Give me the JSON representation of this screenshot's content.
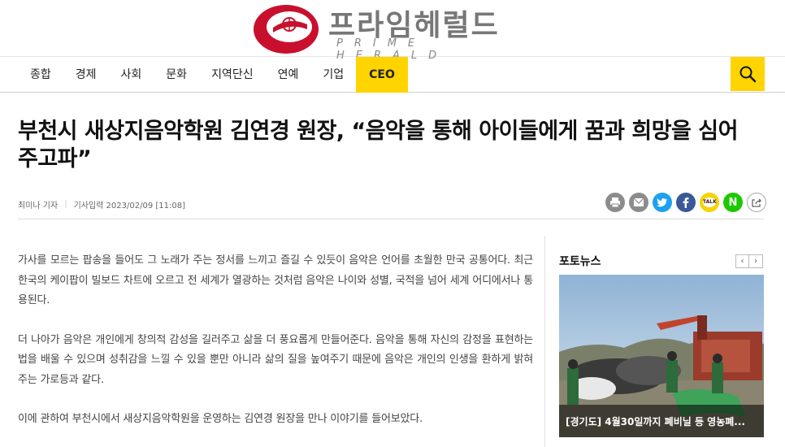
{
  "logo": {
    "title": "프라임헤럴드",
    "subtitle": "PRIME HERALD",
    "colors": {
      "mark": "#c8102e",
      "text": "#777777"
    }
  },
  "nav": {
    "items": [
      {
        "label": "종합"
      },
      {
        "label": "경제"
      },
      {
        "label": "사회"
      },
      {
        "label": "문화"
      },
      {
        "label": "지역단신"
      },
      {
        "label": "연예"
      },
      {
        "label": "기업"
      },
      {
        "label": "CEO",
        "active": true
      }
    ],
    "search_icon": "search-icon",
    "accent": "#ffd400"
  },
  "article": {
    "headline": "부천시 새상지음악학원 김연경 원장, “음악을 통해 아이들에게 꿈과 희망을 심어주고파”",
    "author": "최미나 기자",
    "date_label": "기사입력 2023/02/09 [11:08]",
    "paragraphs": [
      "가사를 모르는 팝송을 들어도 그 노래가 주는 정서를 느끼고 즐길 수 있듯이 음악은 언어를 초월한 만국 공통어다. 최근 한국의 케이팝이 빌보드 차트에 오르고 전 세계가 열광하는 것처럼 음악은 나이와 성별, 국적을 넘어 세계 어디에서나 통용된다.",
      "더 나아가 음악은 개인에게 창의적 감성을 길러주고 삶을 더 풍요롭게 만들어준다. 음악을 통해 자신의 감정을 표현하는 법을 배울 수 있으며 성취감을 느낄 수 있을 뿐만 아니라 삶의 질을 높여주기 때문에 음악은 개인의 인생을 환하게 밝혀주는 가로등과 같다.",
      "이에 관하여 부천시에서 새상지음악학원을 운영하는 김연경 원장을 만나 이야기를 들어보았다."
    ]
  },
  "share": {
    "buttons": [
      {
        "icon": "print-icon",
        "color": "#8c8c8c"
      },
      {
        "icon": "email-icon",
        "color": "#8c8c8c"
      },
      {
        "icon": "twitter-icon",
        "color": "#1da1f2"
      },
      {
        "icon": "facebook-icon",
        "color": "#3b5998"
      },
      {
        "icon": "kakaotalk-icon",
        "label": "TALK",
        "color": "#f5d400"
      },
      {
        "icon": "naver-icon",
        "label": "N",
        "color": "#1ec800"
      },
      {
        "icon": "share-icon",
        "color": "#ffffff"
      }
    ]
  },
  "sidebar": {
    "title": "포토뉴스",
    "prev_label": "‹",
    "next_label": "›",
    "photo_caption": "[경기도] 4월30일까지 폐비닐 등 영농폐..."
  }
}
